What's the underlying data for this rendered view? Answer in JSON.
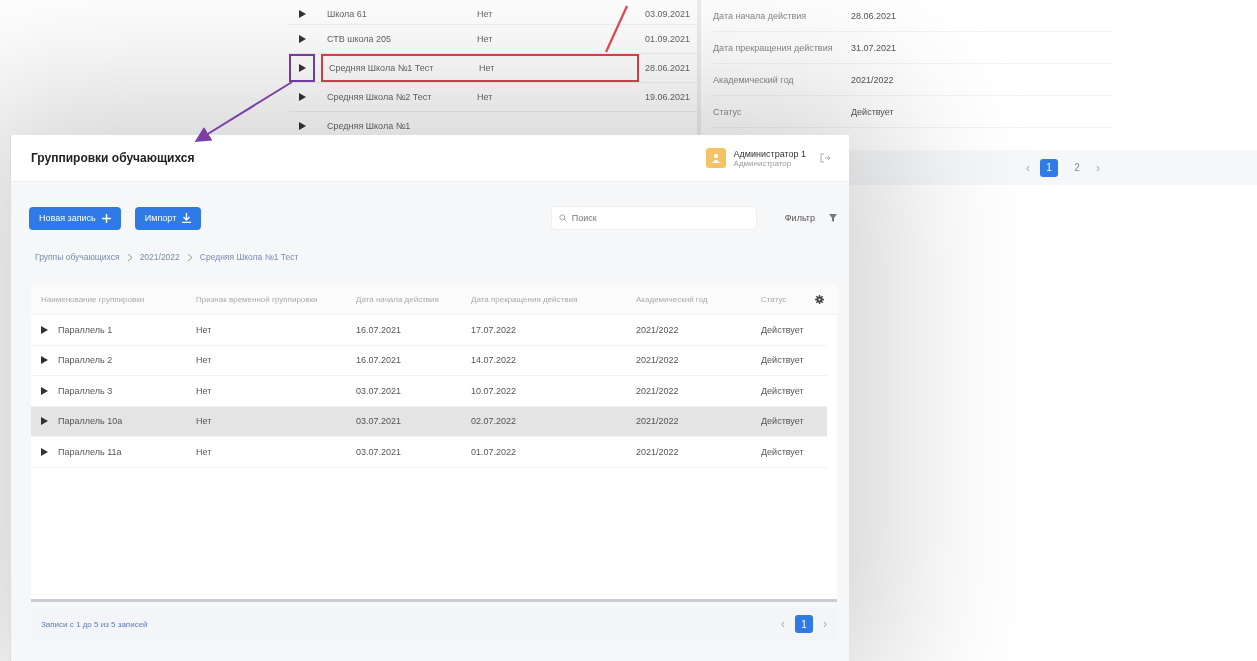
{
  "back_window": {
    "rows": [
      {
        "name": "Школа 61",
        "flag": "Нет",
        "date": "03.09.2021",
        "annotated": false
      },
      {
        "name": "СТВ школа 205",
        "flag": "Нет",
        "date": "01.09.2021",
        "annotated": false
      },
      {
        "name": "Средняя Школа №1 Тест",
        "flag": "Нет",
        "date": "28.06.2021",
        "annotated": true
      },
      {
        "name": "Средняя Школа №2 Тест",
        "flag": "Нет",
        "date": "19.06.2021",
        "annotated": false
      },
      {
        "name": "Средняя Школа №1",
        "annotated": false
      }
    ],
    "details": [
      {
        "label": "Дата начала действия",
        "value": "28.06.2021"
      },
      {
        "label": "Дата прекращения действия",
        "value": "31.07.2021"
      },
      {
        "label": "Академический год",
        "value": "2021/2022"
      },
      {
        "label": "Статус",
        "value": "Действует"
      }
    ],
    "pagination": {
      "prev": "‹",
      "pages": [
        {
          "label": "1",
          "selected": true
        },
        {
          "label": "2",
          "selected": false
        }
      ],
      "next": "›"
    }
  },
  "front_window": {
    "title": "Группировки обучающихся",
    "user": {
      "name": "Администратор 1",
      "role": "Администратор"
    },
    "buttons": [
      {
        "label": "Новая запись"
      },
      {
        "label": "Импорт"
      }
    ],
    "search": {
      "placeholder": "Поиск"
    },
    "filter": "Фильтр",
    "breadcrumbs": [
      "Группы обучающихся",
      "2021/2022",
      "Средняя Школа №1 Тест"
    ],
    "table": {
      "columns": [
        "Наименование группировки",
        "Признак временной группировки",
        "Дата начала действия",
        "Дата прекращения действия",
        "Академический год",
        "Статус"
      ],
      "rows": [
        {
          "cells": [
            "Параллель 1",
            "Нет",
            "16.07.2021",
            "17.07.2022",
            "2021/2022",
            "Действует"
          ],
          "selected": false
        },
        {
          "cells": [
            "Параллель 2",
            "Нет",
            "16.07.2021",
            "14.07.2022",
            "2021/2022",
            "Действует"
          ],
          "selected": false
        },
        {
          "cells": [
            "Параллель 3",
            "Нет",
            "03.07.2021",
            "10.07.2022",
            "2021/2022",
            "Действует"
          ],
          "selected": false
        },
        {
          "cells": [
            "Параллель 10а",
            "Нет",
            "03.07.2021",
            "02.07.2022",
            "2021/2022",
            "Действует"
          ],
          "selected": true
        },
        {
          "cells": [
            "Параллель 11а",
            "Нет",
            "03.07.2021",
            "01.07.2022",
            "2021/2022",
            "Действует"
          ],
          "selected": false
        }
      ]
    },
    "footer": {
      "summary": "Записи с 1 до 5 из 5 записей",
      "pagination": {
        "prev": "‹",
        "pages": [
          {
            "label": "1",
            "selected": true
          }
        ],
        "next": "›"
      }
    }
  }
}
